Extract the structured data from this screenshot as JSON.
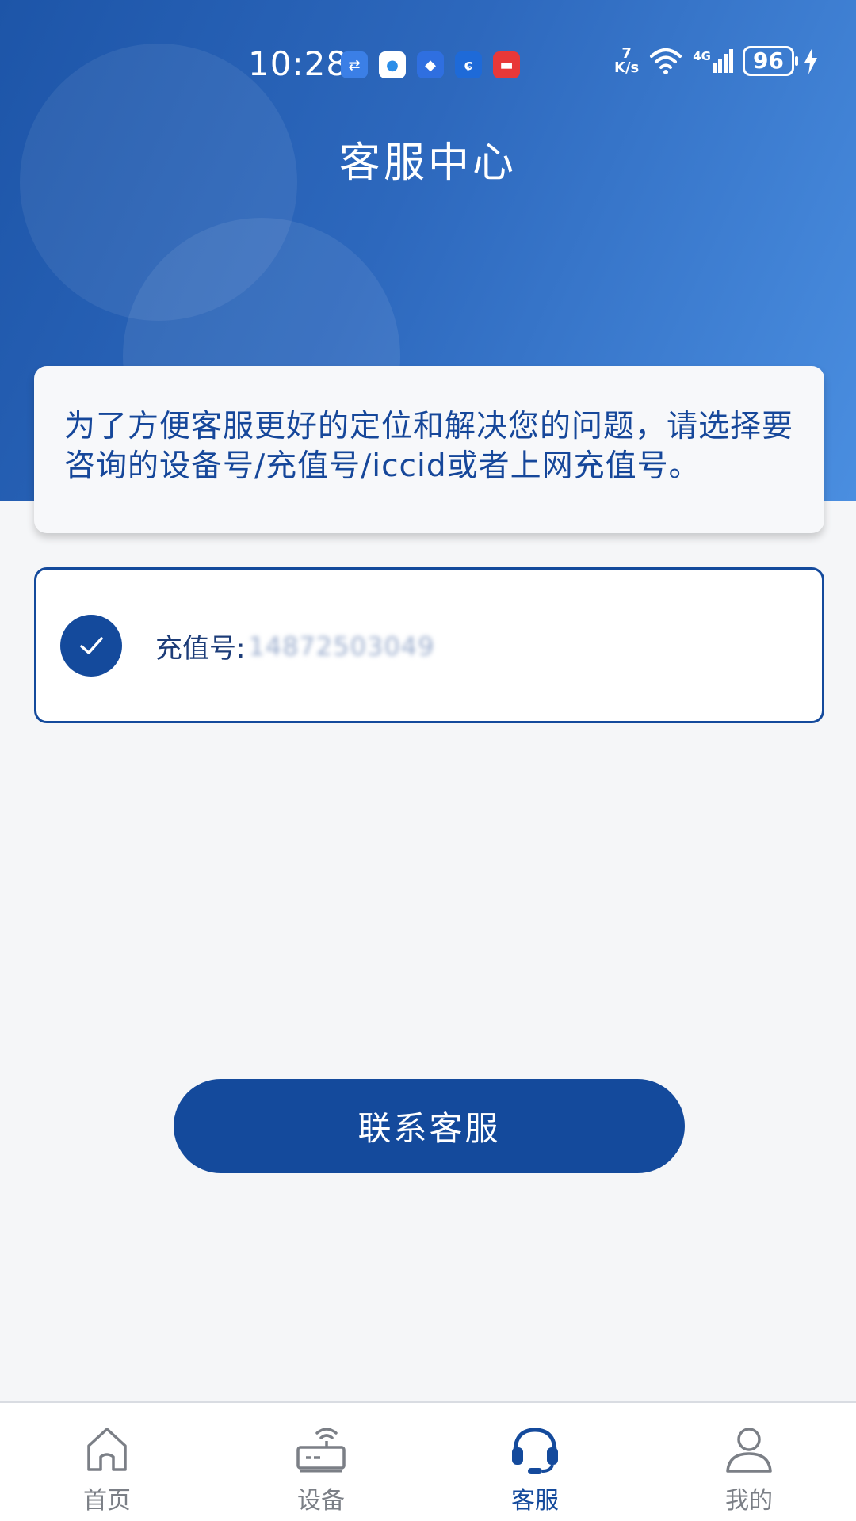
{
  "status_bar": {
    "time": "10:28",
    "net_speed_value": "7",
    "net_speed_unit": "K/s",
    "network_type": "4G",
    "battery": "96",
    "app_icons": [
      "usb-icon",
      "message-icon",
      "app-icon",
      "shrimp-app-icon",
      "book-app-icon"
    ]
  },
  "header": {
    "title": "客服中心"
  },
  "notice": {
    "text": "为了方便客服更好的定位和解决您的问题，请选择要咨询的设备号/充值号/iccid或者上网充值号。"
  },
  "account": {
    "label": "充值号:",
    "value": "14872503049",
    "selected": true
  },
  "contact_button": {
    "label": "联系客服"
  },
  "nav": {
    "items": [
      {
        "label": "首页",
        "icon": "home-icon",
        "active": false
      },
      {
        "label": "设备",
        "icon": "router-icon",
        "active": false
      },
      {
        "label": "客服",
        "icon": "headset-icon",
        "active": true
      },
      {
        "label": "我的",
        "icon": "user-icon",
        "active": false
      }
    ]
  },
  "colors": {
    "primary": "#144a9c",
    "header_start": "#1d55a8",
    "header_end": "#4a8ee0",
    "inactive_nav": "#7b7f86"
  }
}
